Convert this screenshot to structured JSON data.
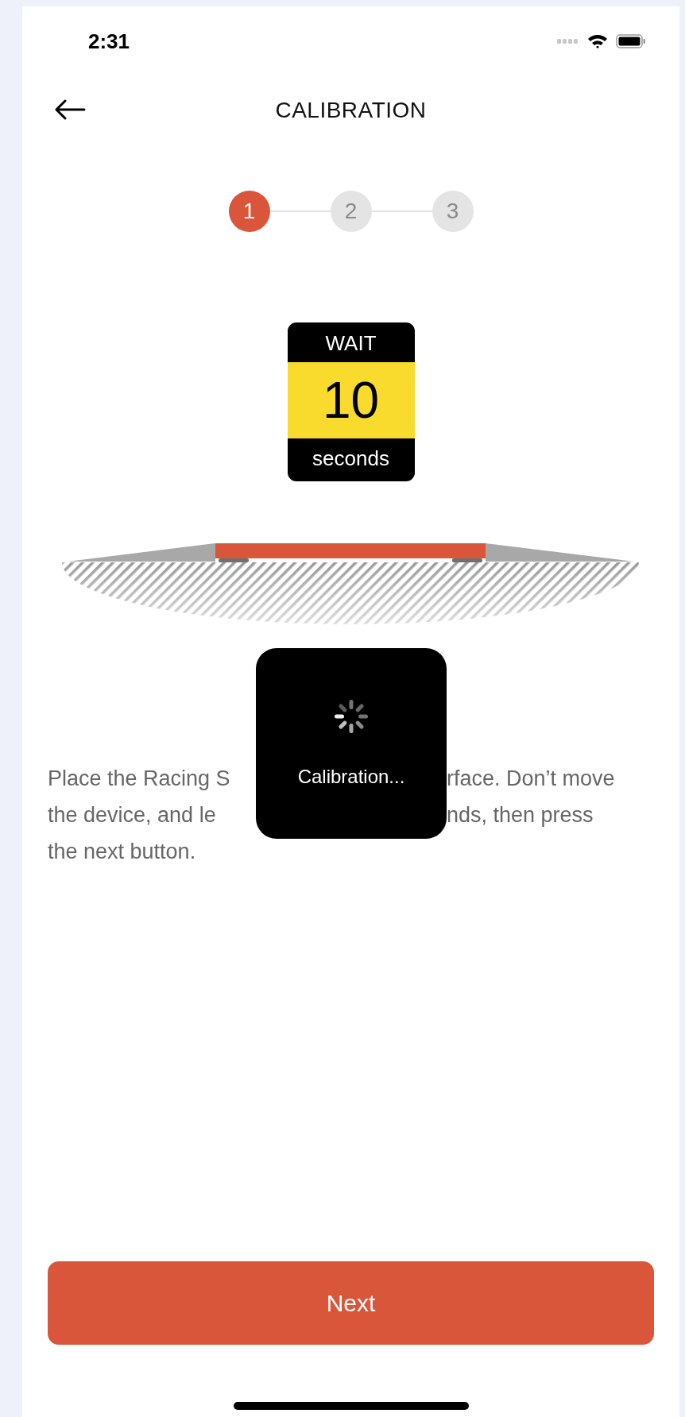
{
  "status_bar": {
    "time": "2:31"
  },
  "header": {
    "title": "CALIBRATION"
  },
  "stepper": [
    {
      "label": "1",
      "selected": true
    },
    {
      "label": "2",
      "selected": false
    },
    {
      "label": "3",
      "selected": false
    }
  ],
  "wait_sign": {
    "top": "WAIT",
    "number": "10",
    "bottom": "seconds"
  },
  "instructions": [
    [
      "Place the Racing S",
      "rface. Don’t move"
    ],
    [
      "the device, and le",
      "nds, then press"
    ],
    [
      "the next button."
    ]
  ],
  "hud": {
    "label": "Calibration..."
  },
  "next_button": {
    "label": "Next"
  }
}
